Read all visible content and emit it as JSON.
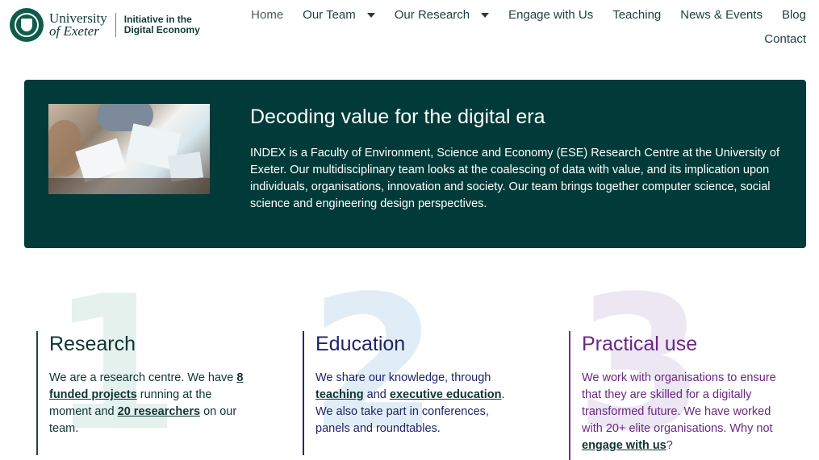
{
  "header": {
    "university_line1": "University",
    "university_line2": "of Exeter",
    "index_line1": "Initiative in the",
    "index_line2": "Digital Economy",
    "nav": [
      {
        "label": "Home"
      },
      {
        "label": "Our Team"
      },
      {
        "label": "Our Research"
      },
      {
        "label": "Engage with Us"
      },
      {
        "label": "Teaching"
      },
      {
        "label": "News & Events"
      },
      {
        "label": "Blog"
      },
      {
        "label": "Contact"
      }
    ]
  },
  "hero": {
    "title": "Decoding value for the digital era",
    "text": "INDEX is a Faculty of Environment, Science and Economy (ESE) Research Centre at the University of Exeter. Our multidisciplinary team looks at the coalescing of data with value, and its implication upon individuals, organisations, innovation and society. Our team brings together computer science, social science and engineering design perspectives."
  },
  "columns": [
    {
      "number": "1",
      "title": "Research",
      "t1": "We are a research centre. We have ",
      "link1": "8 funded projects",
      "t2": " running at the moment and ",
      "link2": "20 researchers",
      "t3": " on our team."
    },
    {
      "number": "2",
      "title": "Education",
      "t1": "We share our knowledge, through ",
      "link1": "teaching",
      "t2": " and ",
      "link2": "executive education",
      "t3": ". We also take part in conferences, panels and roundtables."
    },
    {
      "number": "3",
      "title": "Practical use",
      "t1": "We work with organisations to ensure that they are skilled for a digitally transformed future. We have worked with 20+ elite organisations. Why not ",
      "link1": "engage with us",
      "t2": "?"
    }
  ],
  "colors": {
    "hero_bg": "#013b39",
    "research": "#0f3532",
    "education": "#1f2466",
    "practical": "#6a2882"
  }
}
